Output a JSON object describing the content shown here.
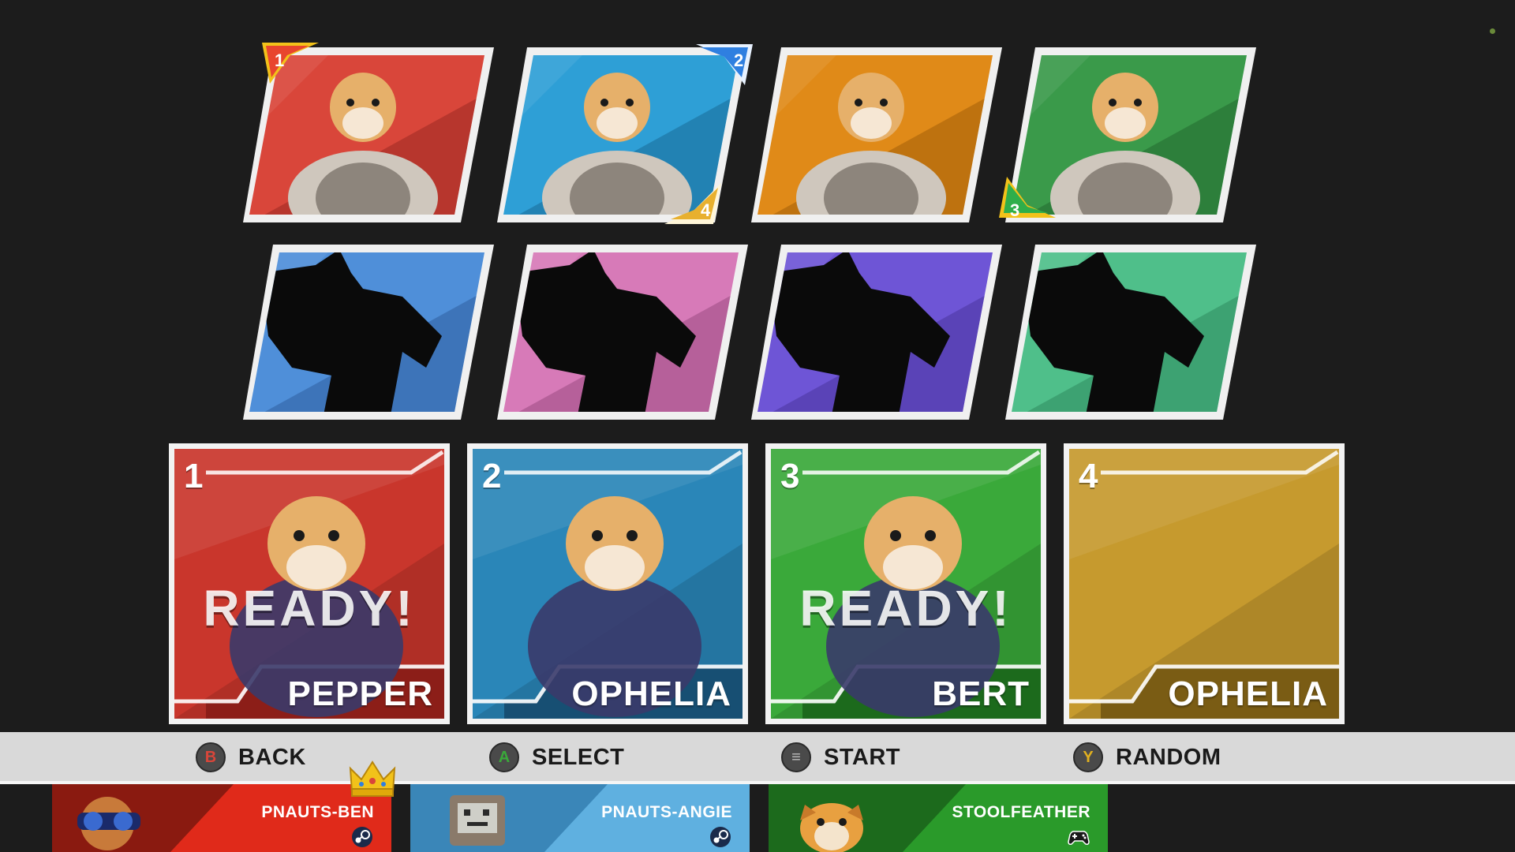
{
  "character_grid": {
    "row1": [
      {
        "id": "corgi",
        "color": "#d9463a",
        "dark": "#9b2a22"
      },
      {
        "id": "cat",
        "color": "#2e9fd6",
        "dark": "#1a6a98"
      },
      {
        "id": "bird",
        "color": "#e08a18",
        "dark": "#a35e0a"
      },
      {
        "id": "pig",
        "color": "#3a9a4a",
        "dark": "#236a30"
      }
    ],
    "row2": [
      {
        "id": "locked-1",
        "color": "#4f8fd9",
        "dark": "#2f5f9f"
      },
      {
        "id": "locked-2",
        "color": "#d77ab8",
        "dark": "#9a4a82"
      },
      {
        "id": "locked-3",
        "color": "#6e55d6",
        "dark": "#4a359e"
      },
      {
        "id": "locked-4",
        "color": "#4fbf8a",
        "dark": "#2f8a5e"
      }
    ],
    "cursors": [
      {
        "number": "1",
        "color": "#e8452e"
      },
      {
        "number": "2",
        "color": "#2f7fe0"
      },
      {
        "number": "4",
        "color": "#e8b02e"
      },
      {
        "number": "3",
        "color": "#2fae4a"
      }
    ]
  },
  "slots": [
    {
      "number": "1",
      "name": "PEPPER",
      "status": "READY!",
      "color": "#c9362c",
      "band": "#8c1e18"
    },
    {
      "number": "2",
      "name": "OPHELIA",
      "status": "",
      "color": "#2a86b8",
      "band": "#174f73"
    },
    {
      "number": "3",
      "name": "BERT",
      "status": "READY!",
      "color": "#3aa93a",
      "band": "#1c6a1c"
    },
    {
      "number": "4",
      "name": "OPHELIA",
      "status": "",
      "color": "#c69a2e",
      "band": "#7a5c14"
    }
  ],
  "controls": [
    {
      "button": "B",
      "label": "BACK",
      "color": "#d9463a"
    },
    {
      "button": "A",
      "label": "SELECT",
      "color": "#3aa93a"
    },
    {
      "button": "≡",
      "label": "START",
      "color": "#9a9a9a"
    },
    {
      "button": "Y",
      "label": "RANDOM",
      "color": "#e0b020"
    }
  ],
  "players": [
    {
      "name": "PNAUTS-BEN",
      "platform": "steam-icon",
      "color": "#e02a1a"
    },
    {
      "name": "PNAUTS-ANGIE",
      "platform": "steam-icon",
      "color": "#5fb0e0"
    },
    {
      "name": "STOOLFEATHER",
      "platform": "gamepad-icon",
      "color": "#2a9a2a"
    }
  ]
}
